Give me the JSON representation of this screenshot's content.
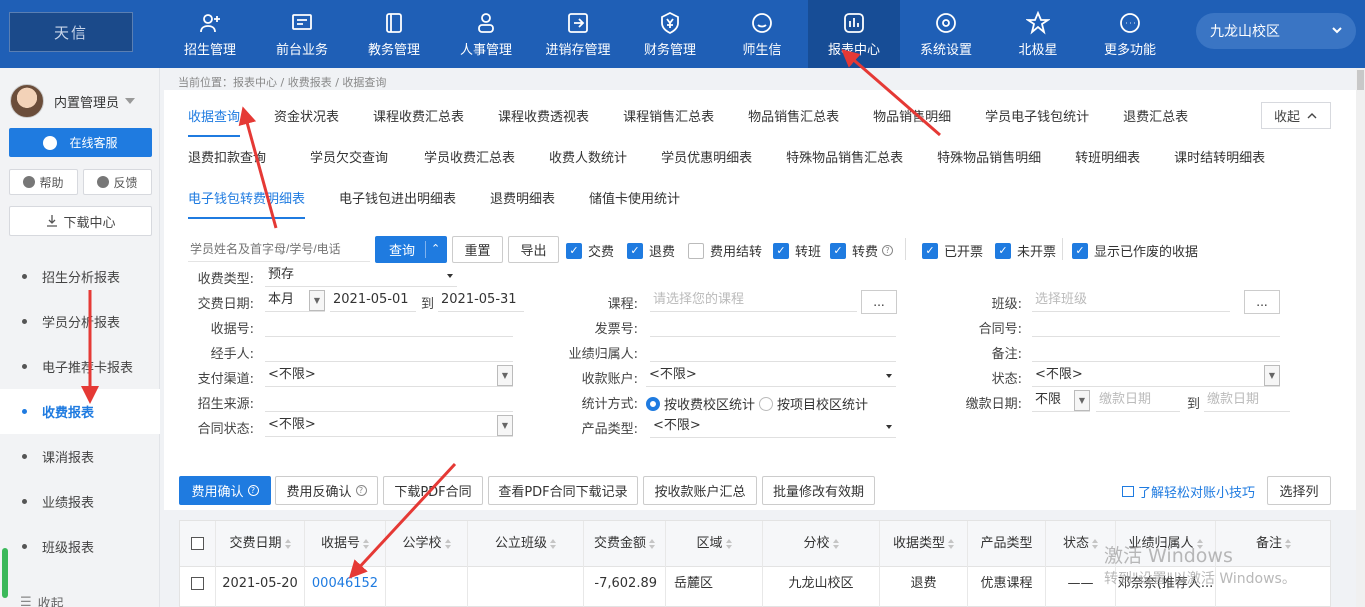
{
  "logo_text": "天信",
  "nav": [
    {
      "label": "招生管理",
      "icon": "user-add-icon"
    },
    {
      "label": "前台业务",
      "icon": "monitor-icon"
    },
    {
      "label": "教务管理",
      "icon": "book-icon"
    },
    {
      "label": "人事管理",
      "icon": "person-icon"
    },
    {
      "label": "进销存管理",
      "icon": "box-arrow-icon"
    },
    {
      "label": "财务管理",
      "icon": "money-shield-icon"
    },
    {
      "label": "师生信",
      "icon": "chat-icon"
    },
    {
      "label": "报表中心",
      "icon": "chart-icon"
    },
    {
      "label": "系统设置",
      "icon": "settings-icon"
    },
    {
      "label": "北极星",
      "icon": "star-icon"
    },
    {
      "label": "更多功能",
      "icon": "more-icon"
    }
  ],
  "campus": "九龙山校区",
  "sidebar": {
    "username": "内置管理员",
    "service": "在线客服",
    "help": "帮助",
    "feedback": "反馈",
    "download": "下载中心",
    "items": [
      "招生分析报表",
      "学员分析报表",
      "电子推荐卡报表",
      "收费报表",
      "课消报表",
      "业绩报表",
      "班级报表"
    ],
    "collapse": "收起"
  },
  "breadcrumb": "当前位置：报表中心 / 收费报表 / 收据查询",
  "tabs_row1": [
    "收据查询",
    "资金状况表",
    "课程收费汇总表",
    "课程收费透视表",
    "课程销售汇总表",
    "物品销售汇总表",
    "物品销售明细",
    "学员电子钱包统计",
    "退费汇总表"
  ],
  "tabs_row2": [
    "退费扣款查询",
    "学员欠交查询",
    "学员收费汇总表",
    "收费人数统计",
    "学员优惠明细表",
    "特殊物品销售汇总表",
    "特殊物品销售明细",
    "转班明细表",
    "课时结转明细表"
  ],
  "tabs_row3": [
    "电子钱包转费明细表",
    "电子钱包进出明细表",
    "退费明细表",
    "储值卡使用统计"
  ],
  "collapse_btn": "收起",
  "search": {
    "placeholder": "学员姓名及首字母/学号/电话",
    "query": "查询",
    "reset": "重置",
    "export": "导出",
    "checks": [
      {
        "label": "交费",
        "checked": true
      },
      {
        "label": "退费",
        "checked": true
      },
      {
        "label": "费用结转",
        "checked": false
      },
      {
        "label": "转班",
        "checked": true
      },
      {
        "label": "转费",
        "checked": true
      },
      {
        "label": "已开票",
        "checked": true
      },
      {
        "label": "未开票",
        "checked": true
      },
      {
        "label": "显示已作废的收据",
        "checked": true
      }
    ]
  },
  "form": {
    "receipt_type_label": "收费类型:",
    "receipt_type_value": "预存",
    "date_label": "交费日期:",
    "date_range": "本月",
    "date_from": "2021-05-01",
    "to": "到",
    "date_to": "2021-05-31",
    "course_label": "课程:",
    "course_ph": "请选择您的课程",
    "class_label": "班级:",
    "class_ph": "选择班级",
    "dots": "...",
    "receipt_no_label": "收据号:",
    "invoice_label": "发票号:",
    "contract_label": "合同号:",
    "handler_label": "经手人:",
    "perf_label": "业绩归属人:",
    "note_label": "备注:",
    "pay_channel_label": "支付渠道:",
    "pay_channel_value": "<不限>",
    "account_label": "收款账户:",
    "account_value": "<不限>",
    "status_label": "状态:",
    "status_value": "<不限>",
    "source_label": "招生来源:",
    "stat_label": "统计方式:",
    "stat_opt1": "按收费校区统计",
    "stat_opt2": "按项目校区统计",
    "pay_date_label": "缴款日期:",
    "pay_date_range": "不限",
    "pay_date_ph": "缴款日期",
    "contract_status_label": "合同状态:",
    "contract_status_value": "<不限>",
    "product_type_label": "产品类型:",
    "product_type_value": "<不限>"
  },
  "actions": [
    "费用确认",
    "费用反确认",
    "下载PDF合同",
    "查看PDF合同下载记录",
    "按收款账户汇总",
    "批量修改有效期"
  ],
  "tip_link": "了解轻松对账小技巧",
  "choose_cols": "选择列",
  "table": {
    "headers": [
      "交费日期",
      "收据号",
      "公学校",
      "公立班级",
      "交费金额",
      "区域",
      "分校",
      "收据类型",
      "产品类型",
      "状态",
      "业绩归属人",
      "备注"
    ],
    "rows": [
      [
        "2021-05-20",
        "00046152",
        "",
        "",
        "-7,602.89",
        "岳麓区",
        "九龙山校区",
        "退费",
        "优惠课程",
        "——",
        "邓奈奈(推荐人...",
        ""
      ]
    ]
  },
  "watermark1": "激活 Windows",
  "watermark2": "转到\"设置\"以激活 Windows。"
}
